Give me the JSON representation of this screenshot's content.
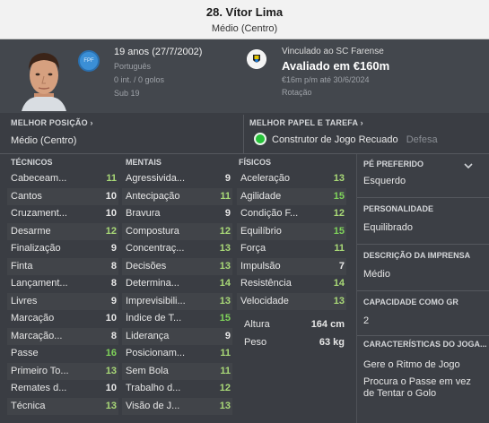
{
  "header": {
    "title": "28. Vítor Lima",
    "position": "Médio (Centro)"
  },
  "profile": {
    "age_line": "19 anos (27/7/2002)",
    "nationality": "Português",
    "caps_goals": "0 int. / 0 golos",
    "youth_level": "Sub 19",
    "flag_text": "FPF",
    "contract_line": "Vinculado ao SC Farense",
    "value": "Avaliado em €160m",
    "wage_line": "€16m p/m até 30/6/2024",
    "squad_status": "Rotação"
  },
  "best_position": {
    "heading": "MELHOR POSIÇÃO ›",
    "value": "Médio (Centro)"
  },
  "best_role": {
    "heading": "MELHOR PAPEL E TAREFA ›",
    "value": "Construtor de Jogo Recuado",
    "duty": "Defesa"
  },
  "technical": {
    "heading": "TÉCNICOS",
    "items": [
      {
        "label": "Cabeceam...",
        "value": "11"
      },
      {
        "label": "Cantos",
        "value": "10"
      },
      {
        "label": "Cruzament...",
        "value": "10"
      },
      {
        "label": "Desarme",
        "value": "12"
      },
      {
        "label": "Finalização",
        "value": "9"
      },
      {
        "label": "Finta",
        "value": "8"
      },
      {
        "label": "Lançament...",
        "value": "8"
      },
      {
        "label": "Livres",
        "value": "9"
      },
      {
        "label": "Marcação",
        "value": "10"
      },
      {
        "label": "Marcação...",
        "value": "8"
      },
      {
        "label": "Passe",
        "value": "16"
      },
      {
        "label": "Primeiro To...",
        "value": "13"
      },
      {
        "label": "Remates d...",
        "value": "10"
      },
      {
        "label": "Técnica",
        "value": "13"
      }
    ]
  },
  "mental": {
    "heading": "MENTAIS",
    "items": [
      {
        "label": "Agressivida...",
        "value": "9"
      },
      {
        "label": "Antecipação",
        "value": "11"
      },
      {
        "label": "Bravura",
        "value": "9"
      },
      {
        "label": "Compostura",
        "value": "12"
      },
      {
        "label": "Concentraç...",
        "value": "13"
      },
      {
        "label": "Decisões",
        "value": "13"
      },
      {
        "label": "Determina...",
        "value": "14"
      },
      {
        "label": "Imprevisibili...",
        "value": "13"
      },
      {
        "label": "Índice de T...",
        "value": "15"
      },
      {
        "label": "Liderança",
        "value": "9"
      },
      {
        "label": "Posicionam...",
        "value": "11"
      },
      {
        "label": "Sem Bola",
        "value": "11"
      },
      {
        "label": "Trabalho d...",
        "value": "12"
      },
      {
        "label": "Visão de J...",
        "value": "13"
      }
    ]
  },
  "physical": {
    "heading": "FÍSICOS",
    "items": [
      {
        "label": "Aceleração",
        "value": "13"
      },
      {
        "label": "Agilidade",
        "value": "15"
      },
      {
        "label": "Condição F...",
        "value": "12"
      },
      {
        "label": "Equilíbrio",
        "value": "15"
      },
      {
        "label": "Força",
        "value": "11"
      },
      {
        "label": "Impulsão",
        "value": "7"
      },
      {
        "label": "Resistência",
        "value": "14"
      },
      {
        "label": "Velocidade",
        "value": "13"
      }
    ],
    "height_label": "Altura",
    "height_value": "164 cm",
    "weight_label": "Peso",
    "weight_value": "63 kg"
  },
  "side": {
    "foot_heading": "PÉ PREFERIDO",
    "foot_value": "Esquerdo",
    "personality_heading": "PERSONALIDADE",
    "personality_value": "Equilibrado",
    "media_heading": "DESCRIÇÃO DA IMPRENSA",
    "media_value": "Médio",
    "gk_heading": "CAPACIDADE COMO GR",
    "gk_value": "2",
    "traits_heading": "CARACTERÍSTICAS DO JOGA...",
    "traits": [
      "Gere o Ritmo de Jogo",
      "Procura o Passe em vez de Tentar o Golo"
    ]
  },
  "colors": {
    "low": "#e8e8e8",
    "mid": "#a9d977",
    "high": "#7fd35a",
    "role_dot": "#27c23a"
  }
}
